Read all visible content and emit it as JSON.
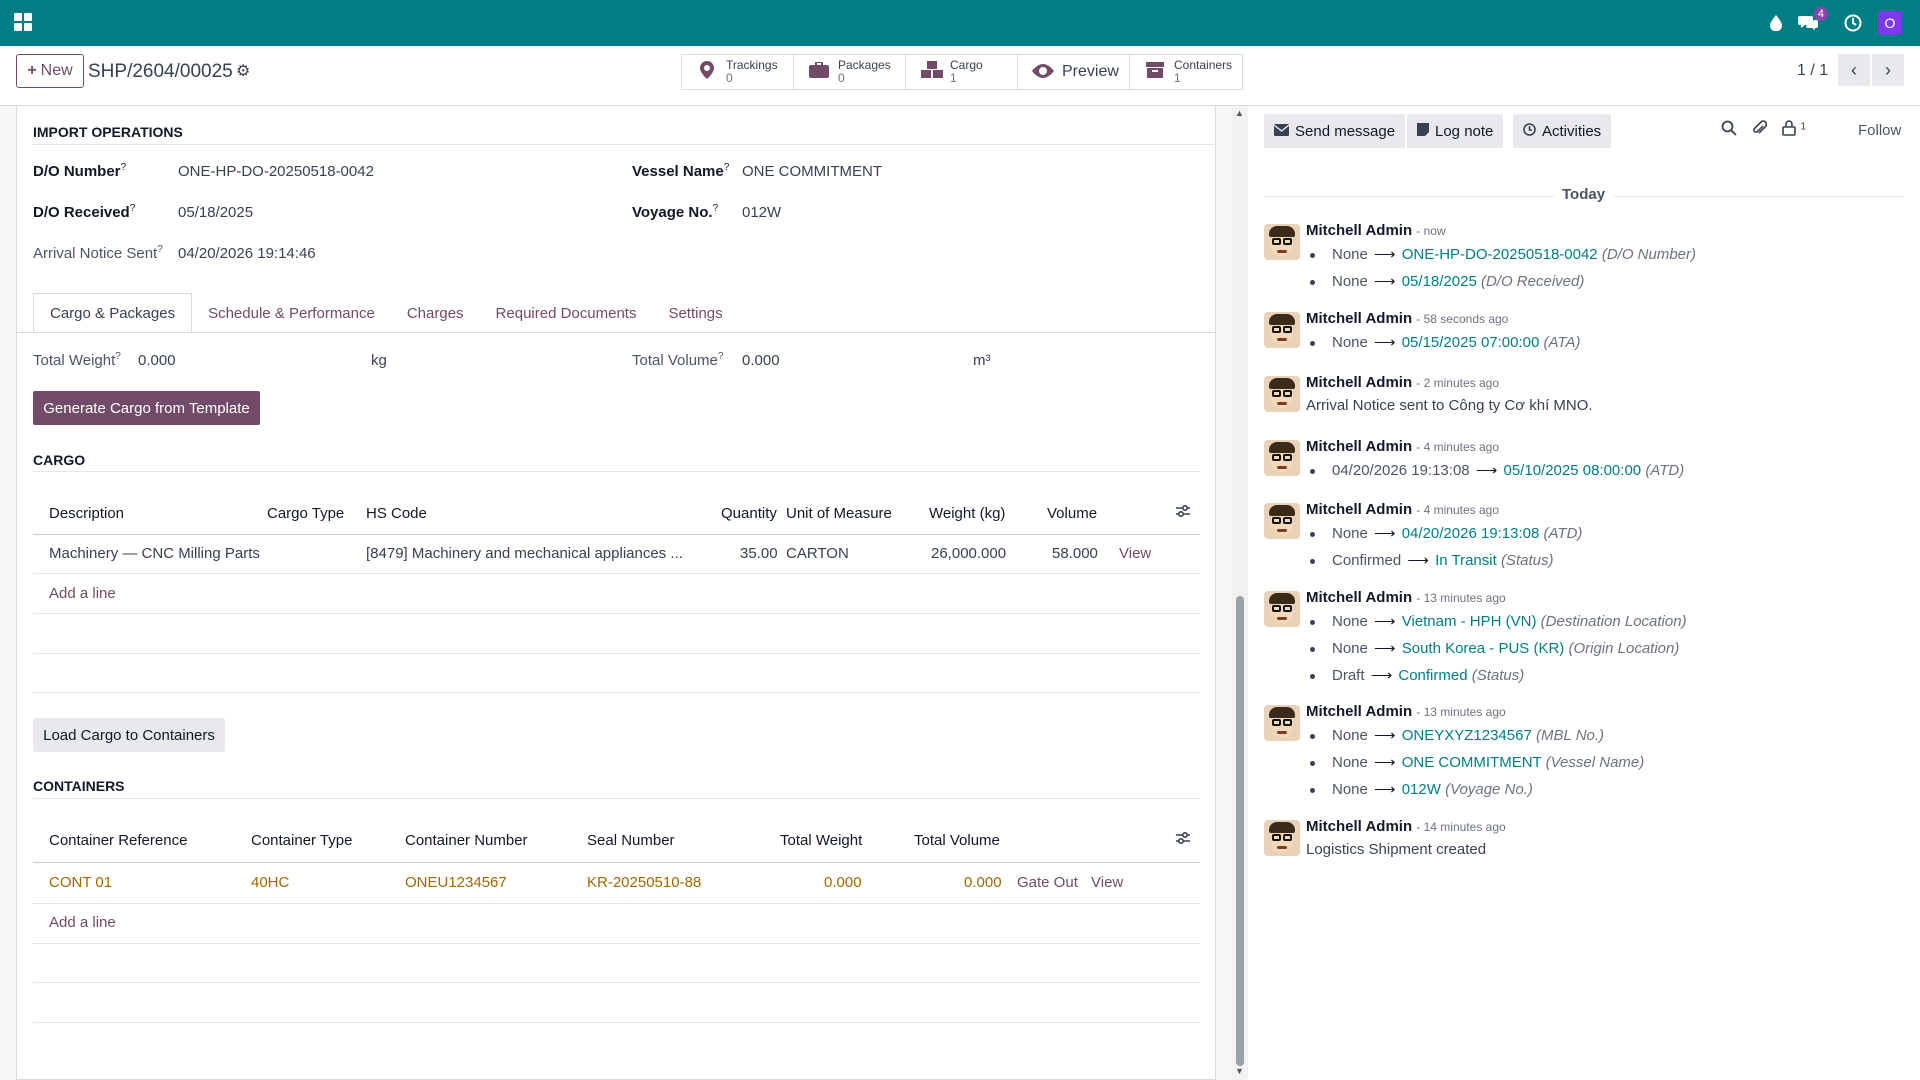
{
  "topbar": {
    "message_badge": "4",
    "user_initial": "O"
  },
  "control_panel": {
    "new_label": "New",
    "record_name": "SHP/2604/00025",
    "smart_buttons": [
      {
        "icon": "map-pin-icon",
        "label": "Trackings",
        "count": "0"
      },
      {
        "icon": "briefcase-icon",
        "label": "Packages",
        "count": "0"
      },
      {
        "icon": "cubes-icon",
        "label": "Cargo",
        "count": "1"
      },
      {
        "icon": "eye-icon",
        "label": "Preview"
      },
      {
        "icon": "archive-icon",
        "label": "Containers",
        "count": "1"
      }
    ],
    "pager": "1 / 1"
  },
  "form": {
    "section_title": "IMPORT OPERATIONS",
    "fields": {
      "do_number_label": "D/O Number",
      "do_number": "ONE-HP-DO-20250518-0042",
      "do_received_label": "D/O Received",
      "do_received": "05/18/2025",
      "arrival_notice_label": "Arrival Notice Sent",
      "arrival_notice": "04/20/2026 19:14:46",
      "vessel_name_label": "Vessel Name",
      "vessel_name": "ONE COMMITMENT",
      "voyage_no_label": "Voyage No.",
      "voyage_no": "012W"
    },
    "tabs": [
      "Cargo & Packages",
      "Schedule & Performance",
      "Charges",
      "Required Documents",
      "Settings"
    ],
    "totals": {
      "weight_label": "Total Weight",
      "weight": "0.000",
      "weight_unit": "kg",
      "volume_label": "Total Volume",
      "volume": "0.000",
      "volume_unit": "m³"
    },
    "generate_button": "Generate Cargo from Template",
    "cargo": {
      "title": "CARGO",
      "headers": [
        "Description",
        "Cargo Type",
        "HS Code",
        "Quantity",
        "Unit of Measure",
        "Weight (kg)",
        "Volume"
      ],
      "row": {
        "description": "Machinery — CNC Milling Parts",
        "cargo_type": "",
        "hs_code": "[8479] Machinery and mechanical appliances ...",
        "quantity": "35.00",
        "uom": "CARTON",
        "weight": "26,000.000",
        "volume": "58.000",
        "action": "View"
      },
      "add_line": "Add a line"
    },
    "load_button": "Load Cargo to Containers",
    "containers": {
      "title": "CONTAINERS",
      "headers": [
        "Container Reference",
        "Container Type",
        "Container Number",
        "Seal Number",
        "Total Weight",
        "Total Volume"
      ],
      "row": {
        "reference": "CONT 01",
        "type": "40HC",
        "number": "ONEU1234567",
        "seal": "KR-20250510-88",
        "weight": "0.000",
        "volume": "0.000",
        "action1": "Gate Out",
        "action2": "View"
      },
      "add_line": "Add a line"
    }
  },
  "chatter": {
    "send_message": "Send message",
    "log_note": "Log note",
    "activities": "Activities",
    "follower_count": "1",
    "follow": "Follow",
    "date_separator": "Today",
    "messages": [
      {
        "author": "Mitchell Admin",
        "time": "- now",
        "tracking": [
          {
            "old": "None",
            "new": "ONE-HP-DO-20250518-0042",
            "field": "(D/O Number)"
          },
          {
            "old": "None",
            "new": "05/18/2025",
            "field": "(D/O Received)"
          }
        ]
      },
      {
        "author": "Mitchell Admin",
        "time": "- 58 seconds ago",
        "tracking": [
          {
            "old": "None",
            "new": "05/15/2025 07:00:00",
            "field": "(ATA)"
          }
        ]
      },
      {
        "author": "Mitchell Admin",
        "time": "- 2 minutes ago",
        "body": "Arrival Notice sent to Công ty Cơ khí MNO."
      },
      {
        "author": "Mitchell Admin",
        "time": "- 4 minutes ago",
        "tracking": [
          {
            "old": "04/20/2026 19:13:08",
            "new": "05/10/2025 08:00:00",
            "field": "(ATD)"
          }
        ]
      },
      {
        "author": "Mitchell Admin",
        "time": "- 4 minutes ago",
        "tracking": [
          {
            "old": "None",
            "new": "04/20/2026 19:13:08",
            "field": "(ATD)"
          },
          {
            "old": "Confirmed",
            "new": "In Transit",
            "field": "(Status)"
          }
        ]
      },
      {
        "author": "Mitchell Admin",
        "time": "- 13 minutes ago",
        "tracking": [
          {
            "old": "None",
            "new": "Vietnam - HPH (VN)",
            "field": "(Destination Location)"
          },
          {
            "old": "None",
            "new": "South Korea - PUS (KR)",
            "field": "(Origin Location)"
          },
          {
            "old": "Draft",
            "new": "Confirmed",
            "field": "(Status)"
          }
        ]
      },
      {
        "author": "Mitchell Admin",
        "time": "- 13 minutes ago",
        "tracking": [
          {
            "old": "None",
            "new": "ONEYXYZ1234567",
            "field": "(MBL No.)"
          },
          {
            "old": "None",
            "new": "ONE COMMITMENT",
            "field": "(Vessel Name)"
          },
          {
            "old": "None",
            "new": "012W",
            "field": "(Voyage No.)"
          }
        ]
      },
      {
        "author": "Mitchell Admin",
        "time": "- 14 minutes ago",
        "body": "Logistics Shipment created"
      }
    ]
  }
}
